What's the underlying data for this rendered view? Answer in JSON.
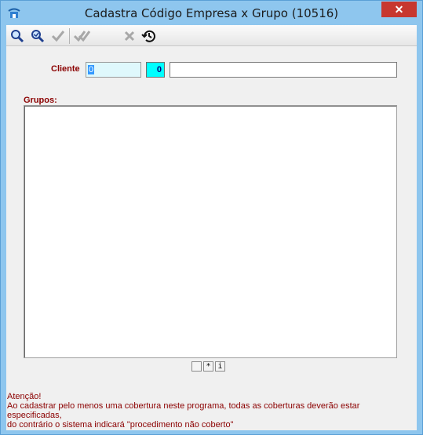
{
  "window": {
    "title": "Cadastra Código Empresa x Grupo (10516)",
    "close_label": "✕"
  },
  "toolbar": {
    "buttons": [
      {
        "name": "search-icon",
        "enabled": true
      },
      {
        "name": "search-next-icon",
        "enabled": true
      },
      {
        "name": "check-icon",
        "enabled": false
      },
      {
        "name": "double-check-icon",
        "enabled": false
      },
      {
        "name": "cancel-icon",
        "enabled": false
      },
      {
        "name": "history-icon",
        "enabled": true
      }
    ]
  },
  "form": {
    "cliente_label": "Cliente",
    "cliente_code": "0",
    "cliente_secondary": "0",
    "cliente_name": "",
    "grupos_label": "Grupos:"
  },
  "grid_nav": {
    "buttons": [
      "",
      "*",
      "i"
    ]
  },
  "warning": {
    "line1": "Atenção!",
    "line2": "Ao cadastrar pelo menos uma cobertura neste programa, todas as coberturas deverão estar especificadas,",
    "line3": "do contrário o sistema indicará \"procedimento não coberto\""
  },
  "colors": {
    "label_red": "#8b0000",
    "titlebar": "#8ec6ee",
    "close_button": "#c7372f",
    "code_field": "#dff8fc",
    "cyan_field": "#00ffff"
  }
}
